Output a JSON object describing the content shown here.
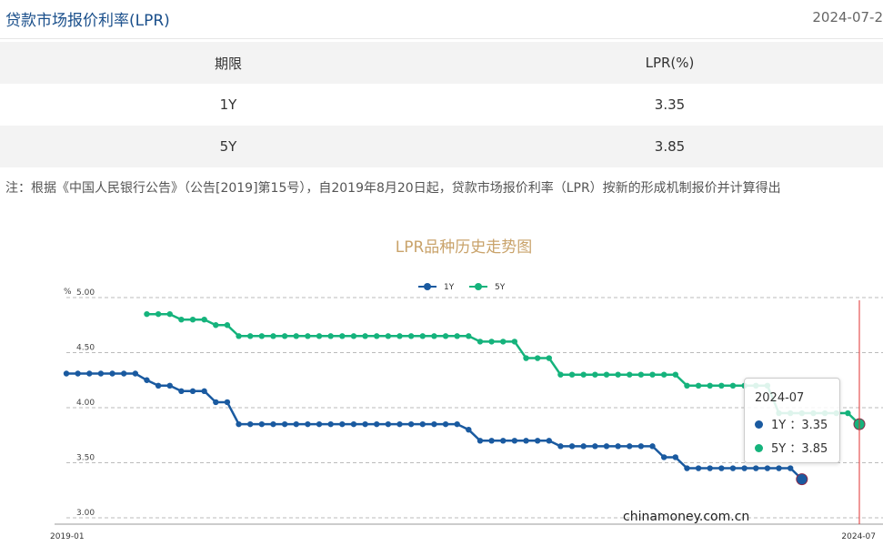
{
  "header": {
    "title": "贷款市场报价利率(LPR)",
    "date": "2024-07-2"
  },
  "table": {
    "headers": [
      "期限",
      "LPR(%)"
    ],
    "rows": [
      {
        "term": "1Y",
        "rate": "3.35"
      },
      {
        "term": "5Y",
        "rate": "3.85"
      }
    ]
  },
  "note": "注：根据《中国人民银行公告》（公告[2019]第15号），自2019年8月20日起，贷款市场报价利率（LPR）按新的形成机制报价并计算得出",
  "chart_data": {
    "type": "line",
    "title": "LPR品种历史走势图",
    "ylabel": "%",
    "ylim": [
      3.0,
      5.0
    ],
    "yticks": [
      "5.00",
      "4.50",
      "4.00",
      "3.50",
      "3.00"
    ],
    "x_start_label": "2019-01",
    "x_end_label": "2024-07",
    "grid": true,
    "legend_position": "top-center",
    "series": [
      {
        "name": "1Y",
        "color": "#1a5aa0",
        "values": [
          4.31,
          4.31,
          4.31,
          4.31,
          4.31,
          4.31,
          4.31,
          4.25,
          4.2,
          4.2,
          4.15,
          4.15,
          4.15,
          4.05,
          4.05,
          3.85,
          3.85,
          3.85,
          3.85,
          3.85,
          3.85,
          3.85,
          3.85,
          3.85,
          3.85,
          3.85,
          3.85,
          3.85,
          3.85,
          3.85,
          3.85,
          3.85,
          3.85,
          3.85,
          3.85,
          3.8,
          3.7,
          3.7,
          3.7,
          3.7,
          3.7,
          3.7,
          3.7,
          3.65,
          3.65,
          3.65,
          3.65,
          3.65,
          3.65,
          3.65,
          3.65,
          3.65,
          3.55,
          3.55,
          3.45,
          3.45,
          3.45,
          3.45,
          3.45,
          3.45,
          3.45,
          3.45,
          3.45,
          3.45,
          3.35
        ]
      },
      {
        "name": "5Y",
        "color": "#15b37c",
        "values": [
          null,
          null,
          null,
          null,
          null,
          null,
          null,
          4.85,
          4.85,
          4.85,
          4.8,
          4.8,
          4.8,
          4.75,
          4.75,
          4.65,
          4.65,
          4.65,
          4.65,
          4.65,
          4.65,
          4.65,
          4.65,
          4.65,
          4.65,
          4.65,
          4.65,
          4.65,
          4.65,
          4.65,
          4.65,
          4.65,
          4.65,
          4.65,
          4.65,
          4.65,
          4.6,
          4.6,
          4.6,
          4.6,
          4.45,
          4.45,
          4.45,
          4.3,
          4.3,
          4.3,
          4.3,
          4.3,
          4.3,
          4.3,
          4.3,
          4.3,
          4.3,
          4.3,
          4.2,
          4.2,
          4.2,
          4.2,
          4.2,
          4.2,
          4.2,
          4.2,
          3.95,
          3.95,
          3.95,
          3.95,
          3.95,
          3.95,
          3.95,
          3.85
        ]
      }
    ],
    "tooltip": {
      "date": "2024-07",
      "items": [
        {
          "name": "1Y",
          "value": "3.35"
        },
        {
          "name": "5Y",
          "value": "3.85"
        }
      ]
    },
    "watermark": "chinamoney.com.cn"
  }
}
